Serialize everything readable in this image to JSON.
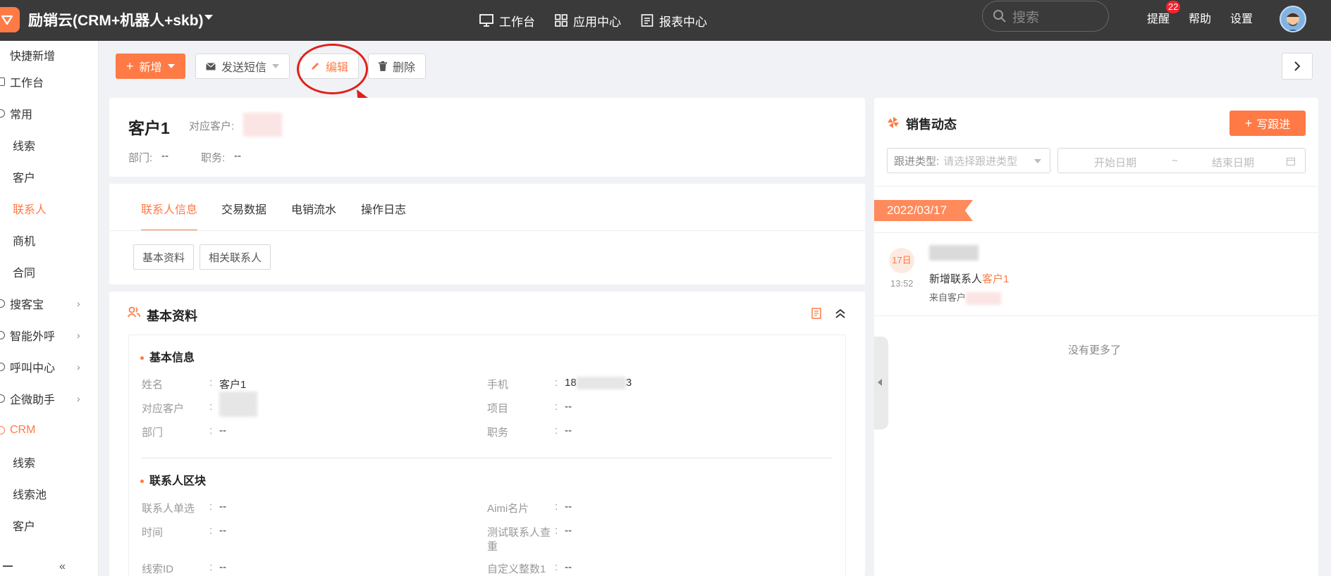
{
  "app": {
    "title": "励销云(CRM+机器人+skb)"
  },
  "topnav": {
    "workbench": "工作台",
    "app_center": "应用中心",
    "report_center": "报表中心",
    "search_placeholder": "搜索",
    "remind": "提醒",
    "remind_badge": "22",
    "help": "帮助",
    "settings": "设置"
  },
  "sidebar": {
    "items": [
      {
        "label": "快捷新增"
      },
      {
        "label": "工作台"
      },
      {
        "label": "常用"
      },
      {
        "label": "线索"
      },
      {
        "label": "客户"
      },
      {
        "label": "联系人"
      },
      {
        "label": "商机"
      },
      {
        "label": "合同"
      },
      {
        "label": "搜客宝"
      },
      {
        "label": "智能外呼"
      },
      {
        "label": "呼叫中心"
      },
      {
        "label": "企微助手"
      },
      {
        "label": "CRM"
      },
      {
        "label": "线索"
      },
      {
        "label": "线索池"
      },
      {
        "label": "客户"
      }
    ]
  },
  "toolbar": {
    "add": "新增",
    "send_sms": "发送短信",
    "edit": "编辑",
    "delete": "删除"
  },
  "header": {
    "name": "客户1",
    "customer_label": "对应客户:",
    "dept_label": "部门:",
    "dept_value": "--",
    "position_label": "职务:",
    "position_value": "--"
  },
  "tabs": [
    "联系人信息",
    "交易数据",
    "电销流水",
    "操作日志"
  ],
  "subtabs": [
    "基本资料",
    "相关联系人"
  ],
  "basic": {
    "title": "基本资料",
    "basic_info_title": "基本信息",
    "fields": {
      "name_label": "姓名",
      "name_value": "客户1",
      "phone_label": "手机",
      "phone_prefix": "18",
      "phone_suffix": "3",
      "customer_label": "对应客户",
      "project_label": "项目",
      "project_value": "--",
      "dept_label": "部门",
      "dept_value": "--",
      "position_label": "职务",
      "position_value": "--"
    },
    "block_title": "联系人区块",
    "block_fields": {
      "single_label": "联系人单选",
      "single_value": "--",
      "aimi_label": "Aimi名片",
      "aimi_value": "--",
      "time_label": "时间",
      "time_value": "--",
      "dup_label_1": "测试联系人查",
      "dup_label_2": "重",
      "dup_value": "--",
      "clue_label": "线索ID",
      "clue_value": "--",
      "int_label": "自定义整数1",
      "int_value": "--"
    }
  },
  "sales": {
    "title": "销售动态",
    "write_btn": "写跟进",
    "type_label": "跟进类型:",
    "type_placeholder": "请选择跟进类型",
    "start_date": "开始日期",
    "date_sep": "~",
    "end_date": "结束日期",
    "date_flag": "2022/03/17",
    "day_chip": "17日",
    "time": "13:52",
    "action_prefix": "新增联系人",
    "action_link": "客户1",
    "from_label": "来自客户",
    "no_more": "没有更多了"
  },
  "colors": {
    "accent": "#ff7a45",
    "topbar": "#3a3a3a",
    "annotation": "#e0201a"
  }
}
